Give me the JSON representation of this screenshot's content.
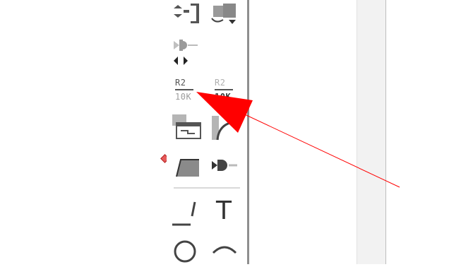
{
  "colors": {
    "canvas_bg": "#ffffff",
    "palette_border": "#8f8f8f",
    "icon_gray": "#555555",
    "icon_light": "#b5b5b5",
    "annotation_red": "#ff0000",
    "marker": "#e65a5a",
    "scroll_panel": "#f2f2f2"
  },
  "palette": {
    "tools": [
      {
        "id": "switch-connector",
        "icon": "switch-connector-icon"
      },
      {
        "id": "data-in-out",
        "icon": "data-io-icon"
      },
      {
        "id": "gate-arrows",
        "icon": "gate-arrows-icon"
      },
      {
        "id": "resistor-label-active",
        "icon": "resistor-label-icon",
        "line1": "R2",
        "line2": "10K"
      },
      {
        "id": "resistor-label-dim",
        "icon": "resistor-label-dim-icon",
        "line1": "R2",
        "line2": "10K"
      },
      {
        "id": "meter-box",
        "icon": "meter-box-icon"
      },
      {
        "id": "curve-bracket",
        "icon": "curve-bracket-icon"
      },
      {
        "id": "ramp-shape",
        "icon": "ramp-shape-icon"
      },
      {
        "id": "plug-connector",
        "icon": "plug-connector-icon"
      },
      {
        "id": "line-tool",
        "icon": "line-tool-icon"
      },
      {
        "id": "text-tool",
        "icon": "text-tool-icon",
        "glyph": "T"
      },
      {
        "id": "circle-tool",
        "icon": "circle-tool-icon"
      },
      {
        "id": "arc-tool",
        "icon": "arc-tool-icon"
      }
    ]
  }
}
